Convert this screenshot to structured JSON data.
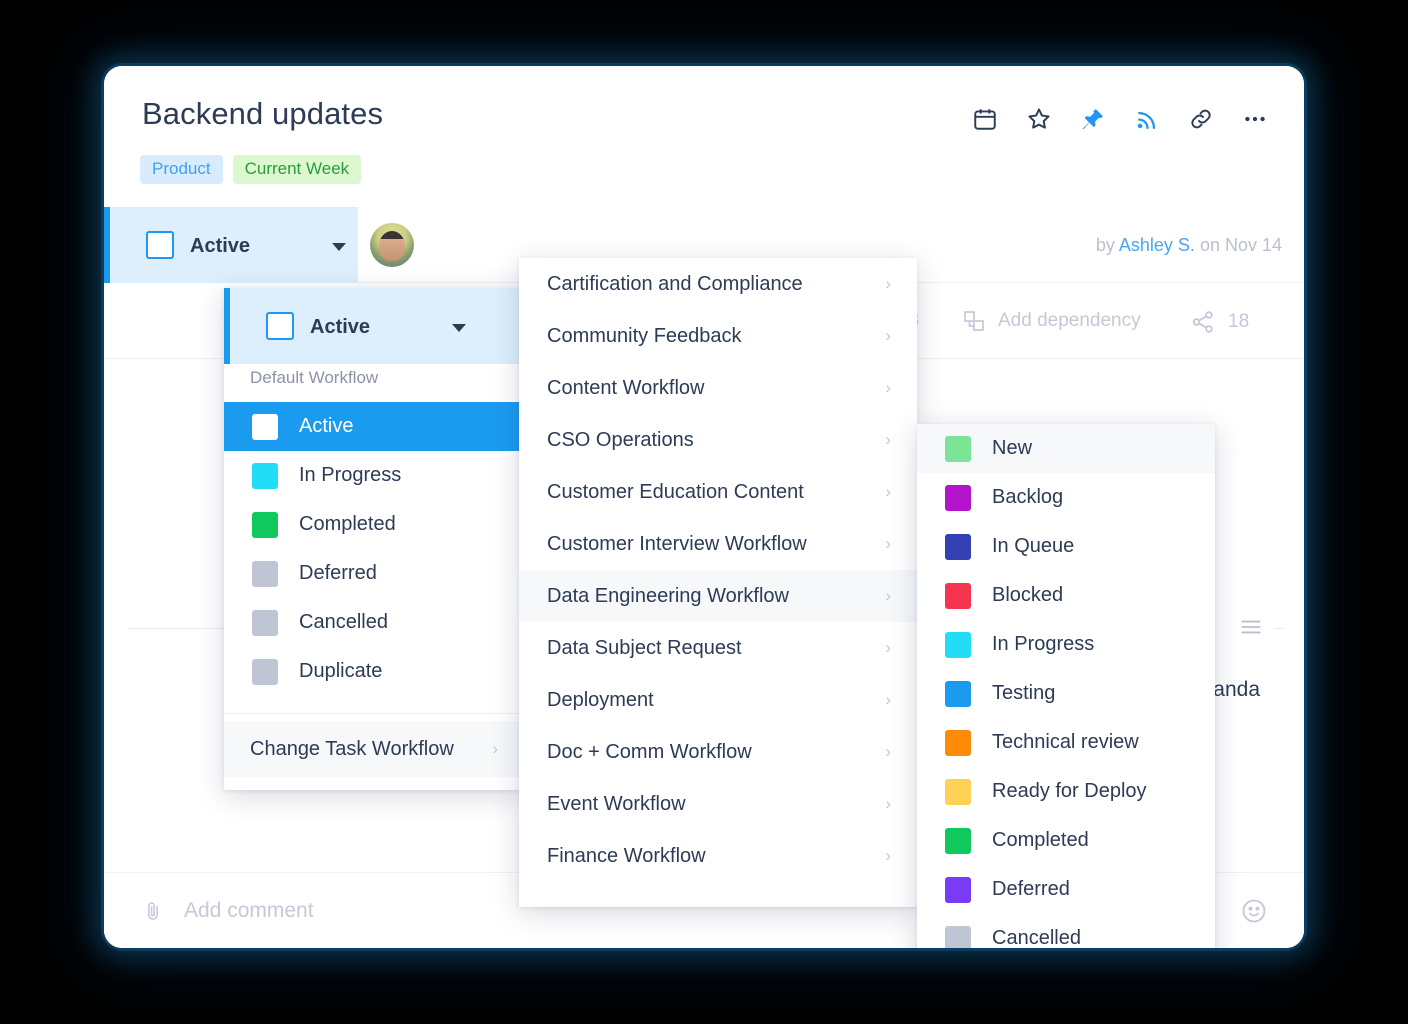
{
  "window": {
    "background_color": "#000000",
    "card_background": "#ffffff"
  },
  "header": {
    "title": "Backend updates",
    "tags": [
      {
        "label": "Product",
        "bg": "#d9ecfd",
        "fg": "#3ca0f5"
      },
      {
        "label": "Current Week",
        "bg": "#ddf8cf",
        "fg": "#2a9c3e"
      }
    ],
    "icons": [
      {
        "name": "calendar-icon",
        "color": "#2d3b55"
      },
      {
        "name": "star-icon",
        "color": "#2d3b55"
      },
      {
        "name": "pin-icon",
        "color": "#2196f3"
      },
      {
        "name": "rss-feed-icon",
        "color": "#2196f3"
      },
      {
        "name": "link-icon",
        "color": "#2d3b55"
      },
      {
        "name": "more-options-icon",
        "color": "#2d3b55"
      }
    ]
  },
  "task_bar": {
    "status_label": "Active",
    "accent_color": "#1b9bf0",
    "byline_prefix": "by",
    "byline_author": "Ashley S.",
    "byline_suffix": "on Nov 14"
  },
  "actions": {
    "attach_files": "Attach files",
    "add_dependency": "Add dependency",
    "share_count": "18"
  },
  "body": {
    "assignee": "Amanda",
    "divider_icons": [
      {
        "name": "paperclip-icon"
      },
      {
        "name": "list-icon"
      }
    ]
  },
  "comment_bar": {
    "placeholder": "Add comment",
    "attach_icon": "paperclip-icon",
    "emoji_icon": "smiley-icon"
  },
  "status_panel": {
    "section_label": "Default Workflow",
    "items": [
      {
        "label": "Active",
        "color": "#ffffff",
        "hollow": true,
        "selected": true
      },
      {
        "label": "In Progress",
        "color": "#22ddf5",
        "hollow": false,
        "selected": false
      },
      {
        "label": "Completed",
        "color": "#0fc95d",
        "hollow": false,
        "selected": false
      },
      {
        "label": "Deferred",
        "color": "#bfc5d4",
        "hollow": false,
        "selected": false
      },
      {
        "label": "Cancelled",
        "color": "#bfc5d4",
        "hollow": false,
        "selected": false
      },
      {
        "label": "Duplicate",
        "color": "#bfc5d4",
        "hollow": false,
        "selected": false
      }
    ],
    "footer_action": "Change Task Workflow"
  },
  "workflow_menu": {
    "items": [
      {
        "label": "Cartification and Compliance",
        "highlighted": false
      },
      {
        "label": "Community Feedback",
        "highlighted": false
      },
      {
        "label": "Content Workflow",
        "highlighted": false
      },
      {
        "label": "CSO Operations",
        "highlighted": false
      },
      {
        "label": "Customer Education Content",
        "highlighted": false
      },
      {
        "label": "Customer Interview Workflow",
        "highlighted": false
      },
      {
        "label": "Data Engineering Workflow",
        "highlighted": true
      },
      {
        "label": "Data Subject Request",
        "highlighted": false
      },
      {
        "label": "Deployment",
        "highlighted": false
      },
      {
        "label": "Doc + Comm Workflow",
        "highlighted": false
      },
      {
        "label": "Event Workflow",
        "highlighted": false
      },
      {
        "label": "Finance Workflow",
        "highlighted": false
      }
    ]
  },
  "status_submenu": {
    "items": [
      {
        "label": "New",
        "color": "#7ce496",
        "highlighted": true
      },
      {
        "label": "Backlog",
        "color": "#b313ca",
        "highlighted": false
      },
      {
        "label": "In Queue",
        "color": "#3341b5",
        "highlighted": false
      },
      {
        "label": "Blocked",
        "color": "#f5344f",
        "highlighted": false
      },
      {
        "label": "In Progress",
        "color": "#22ddf5",
        "highlighted": false
      },
      {
        "label": "Testing",
        "color": "#1b9bf0",
        "highlighted": false
      },
      {
        "label": "Technical review",
        "color": "#fc8b08",
        "highlighted": false
      },
      {
        "label": "Ready for Deploy",
        "color": "#ffd154",
        "highlighted": false
      },
      {
        "label": "Completed",
        "color": "#0fc95d",
        "highlighted": false
      },
      {
        "label": "Deferred",
        "color": "#7a3bf5",
        "highlighted": false
      },
      {
        "label": "Cancelled",
        "color": "#bfc5d4",
        "highlighted": false
      }
    ]
  },
  "chevron_glyph": "›"
}
